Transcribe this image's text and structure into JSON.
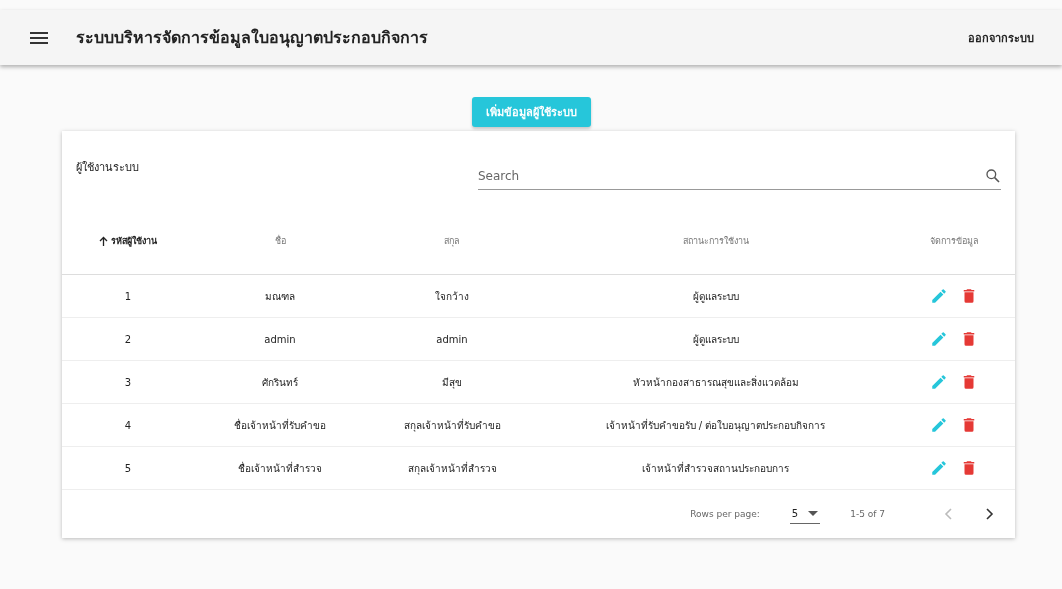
{
  "app_bar": {
    "title": "ระบบบริหารจัดการข้อมูลใบอนุญาตประกอบกิจการ",
    "logout": "ออกจากระบบ"
  },
  "add_button": "เพิ่มข้อมูลผู้ใช้ระบบ",
  "table": {
    "title": "ผู้ใช้งานระบบ",
    "search": {
      "placeholder": "Search"
    },
    "columns": [
      {
        "label": "รหัสผู้ใช้งาน",
        "sorted": true
      },
      {
        "label": "ชื่อ",
        "sorted": false
      },
      {
        "label": "สกุล",
        "sorted": false
      },
      {
        "label": "สถานะการใช้งาน",
        "sorted": false
      },
      {
        "label": "จัดการข้อมูล",
        "sorted": false
      }
    ],
    "rows": [
      {
        "id": "1",
        "first_name": "มณฑล",
        "last_name": "ใจกว้าง",
        "status": "ผู้ดูแลระบบ"
      },
      {
        "id": "2",
        "first_name": "admin",
        "last_name": "admin",
        "status": "ผู้ดูแลระบบ"
      },
      {
        "id": "3",
        "first_name": "ศักรินทร์",
        "last_name": "มีสุข",
        "status": "หัวหน้ากองสาธารณสุขและสิ่งแวดล้อม"
      },
      {
        "id": "4",
        "first_name": "ชื่อเจ้าหน้าที่รับคำขอ",
        "last_name": "สกุลเจ้าหน้าที่รับคำขอ",
        "status": "เจ้าหน้าที่รับคำขอรับ / ต่อใบอนุญาตประกอบกิจการ"
      },
      {
        "id": "5",
        "first_name": "ชื่อเจ้าหน้าที่สำรวจ",
        "last_name": "สกุลเจ้าหน้าที่สำรวจ",
        "status": "เจ้าหน้าที่สำรวจสถานประกอบการ"
      }
    ],
    "pagination": {
      "rows_per_page_label": "Rows per page:",
      "rows_per_page": "5",
      "range": "1-5 of 7",
      "prev_disabled": true,
      "next_disabled": false
    }
  }
}
